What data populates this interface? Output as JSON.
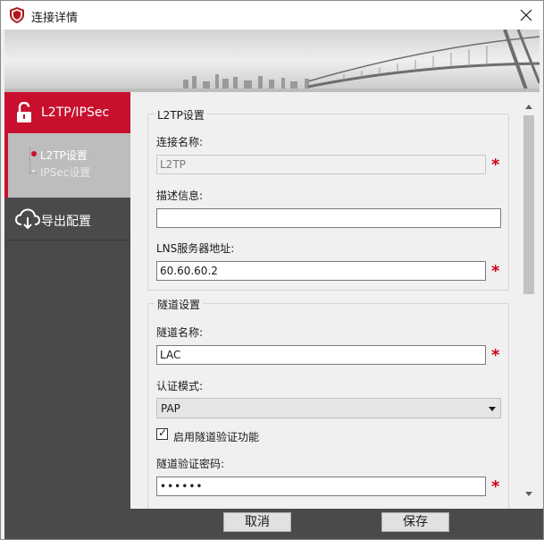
{
  "window": {
    "title": "连接详情",
    "icons": {
      "app": "shield-icon",
      "close": "close-icon"
    }
  },
  "sidebar": {
    "primary_label": "L2TP/IPSec",
    "primary_icon": "unlock-icon",
    "sub_items": [
      {
        "label": "L2TP设置",
        "active": true
      },
      {
        "label": "IPSec设置",
        "active": false
      }
    ],
    "export_label": "导出配置",
    "export_icon": "cloud-download-icon"
  },
  "l2tp_settings": {
    "group_title": "L2TP设置",
    "connection_name_label": "连接名称:",
    "connection_name_value": "L2TP",
    "description_label": "描述信息:",
    "description_value": "",
    "lns_address_label": "LNS服务器地址:",
    "lns_address_value": "60.60.60.2"
  },
  "tunnel_settings": {
    "group_title": "隧道设置",
    "tunnel_name_label": "隧道名称:",
    "tunnel_name_value": "LAC",
    "auth_mode_label": "认证模式:",
    "auth_mode_value": "PAP",
    "enable_auth_label": "启用隧道验证功能",
    "enable_auth_checked": true,
    "tunnel_password_label": "隧道验证密码:",
    "tunnel_password_value": "••••••"
  },
  "required_mark": "*",
  "footer": {
    "cancel_label": "取消",
    "save_label": "保存"
  },
  "colors": {
    "accent": "#c8102e",
    "sidebar_bg": "#4a4a4a",
    "required": "#d0021b"
  }
}
